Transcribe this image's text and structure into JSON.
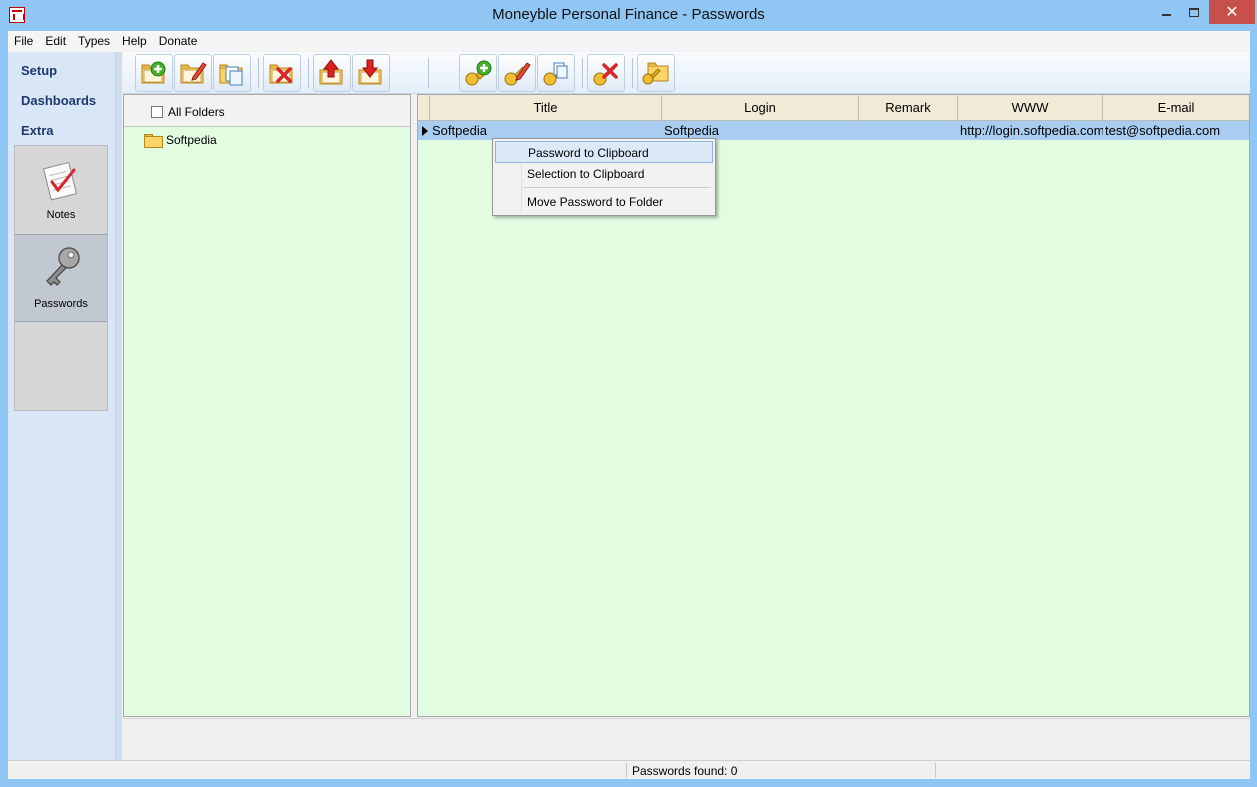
{
  "window": {
    "title": "Moneyble Personal Finance - Passwords"
  },
  "menu": [
    "File",
    "Edit",
    "Types",
    "Help",
    "Donate"
  ],
  "nav": {
    "links": [
      "Setup",
      "Dashboards",
      "Extra"
    ],
    "tiles": [
      {
        "label": "Notes",
        "icon": "notes-checklist-icon",
        "active": false
      },
      {
        "label": "Passwords",
        "icon": "key-icon",
        "active": true
      }
    ]
  },
  "toolbar": {
    "folder_group": [
      "add-folder-icon",
      "edit-folder-icon",
      "copy-folder-icon",
      "delete-folder-icon",
      "move-up-icon",
      "move-down-icon"
    ],
    "password_group": [
      "add-password-icon",
      "edit-password-icon",
      "copy-password-icon",
      "delete-password-icon",
      "move-to-folder-icon"
    ]
  },
  "folders": {
    "all_label": "All Folders",
    "all_checked": false,
    "items": [
      "Softpedia"
    ]
  },
  "grid": {
    "columns": [
      "Title",
      "Login",
      "Remark",
      "WWW",
      "E-mail"
    ],
    "rows": [
      {
        "title": "Softpedia",
        "login": "Softpedia",
        "remark": "",
        "www": "http://login.softpedia.com",
        "email": "test@softpedia.com"
      }
    ]
  },
  "context_menu": {
    "items": [
      "Password to Clipboard",
      "Selection to Clipboard",
      "Move Password to Folder"
    ],
    "highlighted": "Password to Clipboard"
  },
  "status": {
    "text": "Passwords found: 0"
  }
}
